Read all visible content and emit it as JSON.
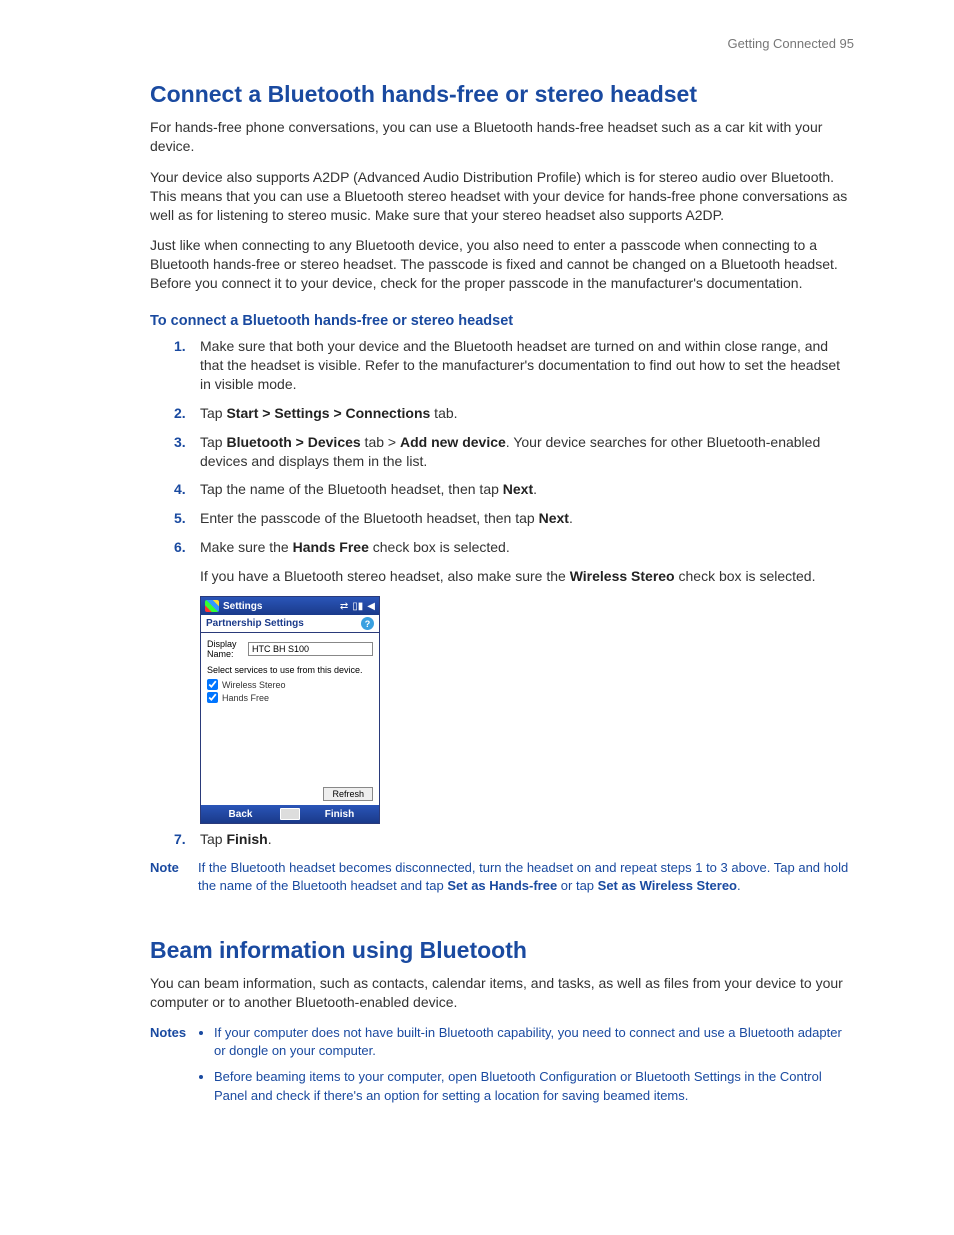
{
  "header": {
    "breadcrumb": "Getting Connected  95"
  },
  "section1": {
    "title": "Connect a Bluetooth hands-free or stereo headset",
    "p1": "For hands-free phone conversations, you can use a Bluetooth hands-free headset such as a car kit with your device.",
    "p2": "Your device also supports A2DP (Advanced Audio Distribution Profile) which is for stereo audio over Bluetooth. This means that you can use a Bluetooth stereo headset with your device for hands-free phone conversations as well as for listening to stereo music. Make sure that your stereo headset also supports A2DP.",
    "p3": "Just like when connecting to any Bluetooth device, you also need to enter a passcode when connecting to a Bluetooth hands-free or stereo headset. The passcode is fixed and cannot be changed on a Bluetooth headset. Before you connect it to your device, check for the proper passcode in the manufacturer's documentation.",
    "sub1": "To connect a Bluetooth hands-free or stereo headset",
    "step1": "Make sure that both your device and the Bluetooth headset are turned on and within close range, and that the headset is visible. Refer to the manufacturer's documentation to find out how to set the headset in visible mode.",
    "step2_pre": "Tap ",
    "step2_bold": "Start > Settings > Connections",
    "step2_post": " tab.",
    "step3_pre": "Tap ",
    "step3_b1": "Bluetooth > Devices",
    "step3_mid": " tab > ",
    "step3_b2": "Add new device",
    "step3_post": ". Your device searches for other Bluetooth-enabled devices and displays them in the list.",
    "step4_pre": "Tap the name of the Bluetooth headset, then tap ",
    "step4_b": "Next",
    "step4_post": ".",
    "step5_pre": "Enter the passcode of the Bluetooth headset, then tap ",
    "step5_b": "Next",
    "step5_post": ".",
    "step6_pre": "Make sure the ",
    "step6_b": "Hands Free",
    "step6_post": " check box is selected.",
    "step6_extra_pre": "If you have a Bluetooth stereo headset, also make sure the ",
    "step6_extra_b": "Wireless Stereo",
    "step6_extra_post": " check box is selected.",
    "step7_pre": "Tap ",
    "step7_b": "Finish",
    "step7_post": ".",
    "note_label": "Note",
    "note_pre": "If the Bluetooth headset becomes disconnected, turn the headset on and repeat steps 1 to 3 above. Tap and hold the name of the Bluetooth headset and tap ",
    "note_b1": "Set as Hands-free",
    "note_mid": " or tap ",
    "note_b2": "Set as Wireless Stereo",
    "note_post": "."
  },
  "wm": {
    "title": "Settings",
    "panel": "Partnership Settings",
    "display_label": "Display Name:",
    "display_value": "HTC BH S100",
    "instruct": "Select services to use from this device.",
    "chk1": "Wireless Stereo",
    "chk2": "Hands Free",
    "refresh": "Refresh",
    "back": "Back",
    "finish": "Finish"
  },
  "section2": {
    "title": "Beam information using Bluetooth",
    "p1": "You can beam information, such as contacts, calendar items, and tasks, as well as files from your device to your computer or to another Bluetooth-enabled device.",
    "notes_label": "Notes",
    "note1": "If your computer does not have built-in Bluetooth capability, you need to connect and use a Bluetooth adapter or dongle on your computer.",
    "note2": "Before beaming items to your computer, open Bluetooth Configuration or Bluetooth Settings in the Control Panel and check if there's an option for setting a location for saving beamed items."
  }
}
